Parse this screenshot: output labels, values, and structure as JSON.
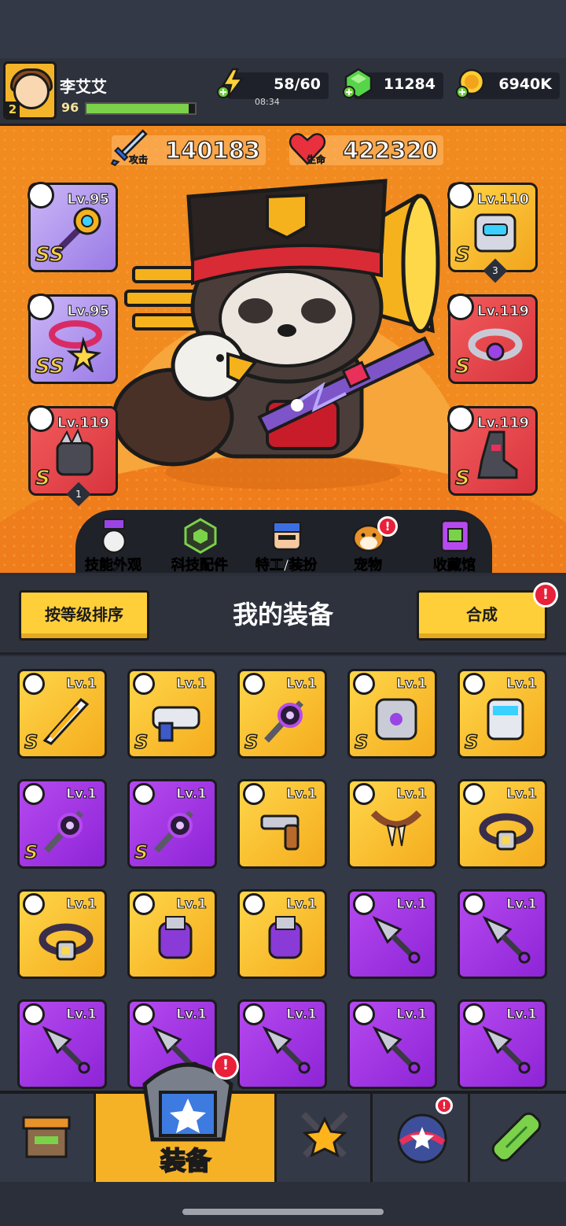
{
  "player": {
    "name": "李艾艾",
    "level": "96",
    "avatar_badge": "2",
    "xp_fraction": 0.94
  },
  "resources": {
    "energy": "58/60",
    "energy_timer": "08:34",
    "gems": "11284",
    "coins": "6940K"
  },
  "stats": {
    "attack_value": "140183",
    "attack_label": "攻击",
    "hp_value": "422320",
    "hp_label": "生命"
  },
  "equipped": {
    "weapon_top": {
      "level": "Lv.95",
      "grade": "SS"
    },
    "necklace": {
      "level": "Lv.95",
      "grade": "SS"
    },
    "gloves": {
      "level": "Lv.119",
      "grade": "S",
      "count": "1"
    },
    "armor": {
      "level": "Lv.110",
      "grade": "S",
      "count": "3"
    },
    "belt": {
      "level": "Lv.119",
      "grade": "S"
    },
    "boots": {
      "level": "Lv.119",
      "grade": "S"
    }
  },
  "hero_menu": [
    {
      "label": "技能外观",
      "icon": "skin-icon"
    },
    {
      "label": "科技配件",
      "icon": "tech-icon"
    },
    {
      "label": "特工/装扮",
      "icon": "agent-icon"
    },
    {
      "label": "宠物",
      "icon": "pet-icon"
    },
    {
      "label": "收藏馆",
      "icon": "collection-icon"
    }
  ],
  "equip_header": {
    "sort_button": "按等级排序",
    "title": "我的装备",
    "merge_button": "合成",
    "alert": "!"
  },
  "inventory": [
    {
      "level": "Lv.1",
      "color": "yellow",
      "grade": "S",
      "icon": "sword-icon"
    },
    {
      "level": "Lv.1",
      "color": "yellow",
      "grade": "S",
      "icon": "blaster-icon"
    },
    {
      "level": "Lv.1",
      "color": "yellow",
      "grade": "S",
      "icon": "void-staff-icon"
    },
    {
      "level": "Lv.1",
      "color": "yellow",
      "grade": "S",
      "icon": "armor-icon"
    },
    {
      "level": "Lv.1",
      "color": "yellow",
      "grade": "S",
      "icon": "gauntlet-icon"
    },
    {
      "level": "Lv.1",
      "color": "purple",
      "grade": "S",
      "icon": "void-staff-icon"
    },
    {
      "level": "Lv.1",
      "color": "purple",
      "grade": "S",
      "icon": "void-staff-icon"
    },
    {
      "level": "Lv.1",
      "color": "yellow",
      "grade": "",
      "icon": "revolver-icon"
    },
    {
      "level": "Lv.1",
      "color": "yellow",
      "grade": "",
      "icon": "fang-necklace-icon"
    },
    {
      "level": "Lv.1",
      "color": "yellow",
      "grade": "",
      "icon": "belt-icon"
    },
    {
      "level": "Lv.1",
      "color": "yellow",
      "grade": "",
      "icon": "belt-icon"
    },
    {
      "level": "Lv.1",
      "color": "yellow",
      "grade": "",
      "icon": "glove-icon"
    },
    {
      "level": "Lv.1",
      "color": "yellow",
      "grade": "",
      "icon": "glove-icon"
    },
    {
      "level": "Lv.1",
      "color": "purple",
      "grade": "",
      "icon": "kunai-icon"
    },
    {
      "level": "Lv.1",
      "color": "purple",
      "grade": "",
      "icon": "kunai-icon"
    },
    {
      "level": "Lv.1",
      "color": "purple",
      "grade": "",
      "icon": "kunai-icon"
    },
    {
      "level": "Lv.1",
      "color": "purple",
      "grade": "",
      "icon": "kunai-icon"
    },
    {
      "level": "Lv.1",
      "color": "purple",
      "grade": "",
      "icon": "kunai-icon"
    },
    {
      "level": "Lv.1",
      "color": "purple",
      "grade": "",
      "icon": "kunai-icon"
    },
    {
      "level": "Lv.1",
      "color": "purple",
      "grade": "",
      "icon": "kunai-icon"
    }
  ],
  "bottom_nav": {
    "active_label": "装备",
    "alert": "!"
  },
  "colors": {
    "hero_bg": "#f18a1f",
    "item_yellow": "#ffd64a",
    "item_purple": "#b64af0",
    "accent_red": "#e8203a"
  }
}
